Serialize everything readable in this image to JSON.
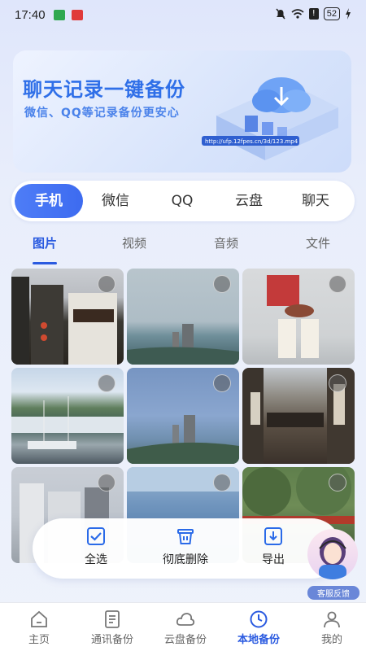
{
  "status_bar": {
    "time": "17:40",
    "battery": "52"
  },
  "banner": {
    "title": "聊天记录一键备份",
    "subtitle": "微信、QQ等记录备份更安心",
    "url_text": "http://ufp.12fpes.cn/3d/123.mp4"
  },
  "source_tabs": [
    {
      "label": "手机",
      "active": true
    },
    {
      "label": "微信",
      "active": false
    },
    {
      "label": "QQ",
      "active": false
    },
    {
      "label": "云盘",
      "active": false
    },
    {
      "label": "聊天",
      "active": false
    }
  ],
  "media_tabs": [
    {
      "label": "图片",
      "active": true
    },
    {
      "label": "视频",
      "active": false
    },
    {
      "label": "音频",
      "active": false
    },
    {
      "label": "文件",
      "active": false
    }
  ],
  "photos": [
    {
      "name": "old-street-building",
      "selected": false
    },
    {
      "name": "lighthouse-coast",
      "selected": false
    },
    {
      "name": "tea-cups-table",
      "selected": false
    },
    {
      "name": "harbor-boats",
      "selected": false
    },
    {
      "name": "lighthouse-blue-sky",
      "selected": false
    },
    {
      "name": "old-street-shops",
      "selected": false
    },
    {
      "name": "city-buildings",
      "selected": false
    },
    {
      "name": "sea-view",
      "selected": false
    },
    {
      "name": "green-trees",
      "selected": false
    }
  ],
  "actions": {
    "select_all": "全选",
    "delete_permanently": "彻底删除",
    "export": "导出"
  },
  "customer_service": {
    "label": "客服反馈"
  },
  "bottom_nav": [
    {
      "label": "主页",
      "active": false
    },
    {
      "label": "通讯备份",
      "active": false
    },
    {
      "label": "云盘备份",
      "active": false
    },
    {
      "label": "本地备份",
      "active": true
    },
    {
      "label": "我的",
      "active": false
    }
  ],
  "colors": {
    "accent": "#2a5ae0",
    "tab_active_bg": "#4e7df7"
  }
}
